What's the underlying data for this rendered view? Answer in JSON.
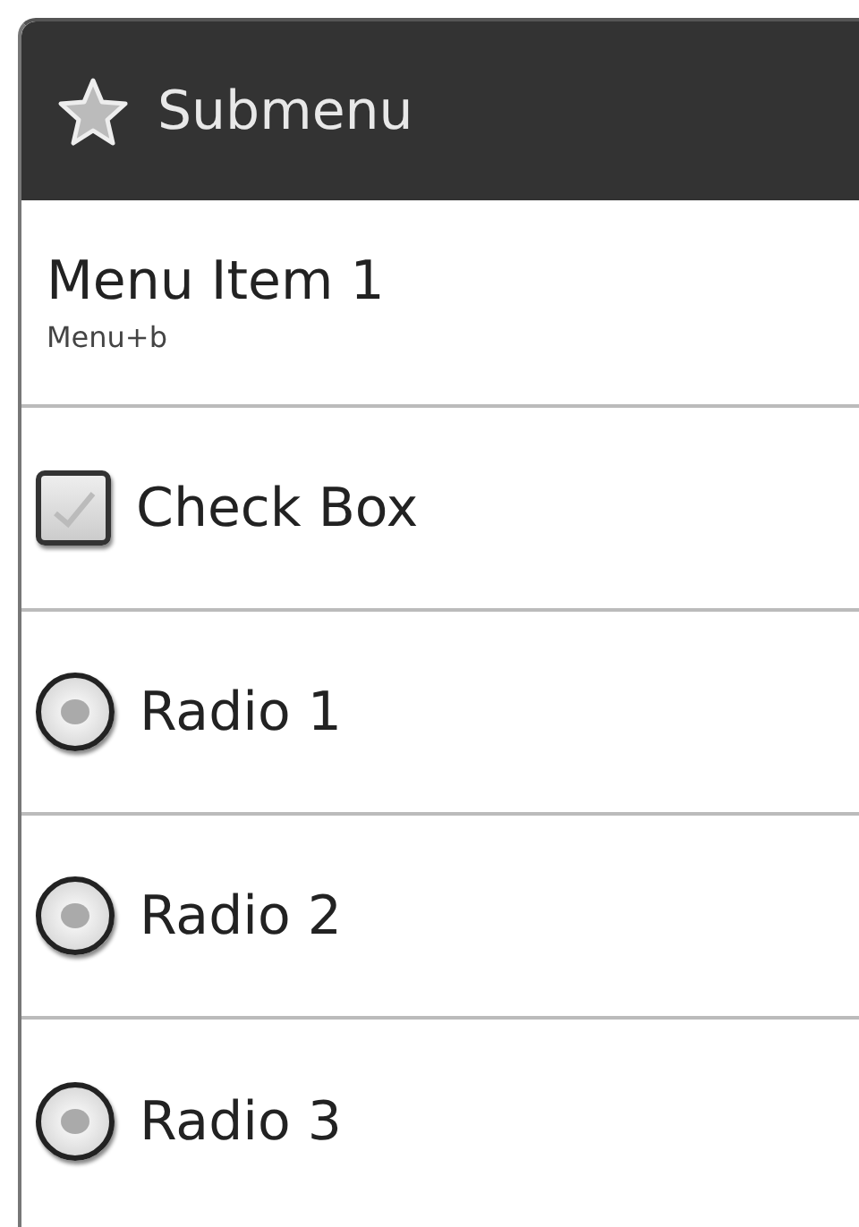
{
  "header": {
    "title": "Submenu"
  },
  "items": [
    {
      "kind": "plain",
      "label": "Menu Item 1",
      "shortcut": "Menu+b"
    },
    {
      "kind": "checkbox",
      "label": "Check Box",
      "checked": false
    },
    {
      "kind": "radio",
      "label": "Radio 1",
      "selected": false
    },
    {
      "kind": "radio",
      "label": "Radio 2",
      "selected": false
    },
    {
      "kind": "radio",
      "label": "Radio 3",
      "selected": false
    }
  ]
}
